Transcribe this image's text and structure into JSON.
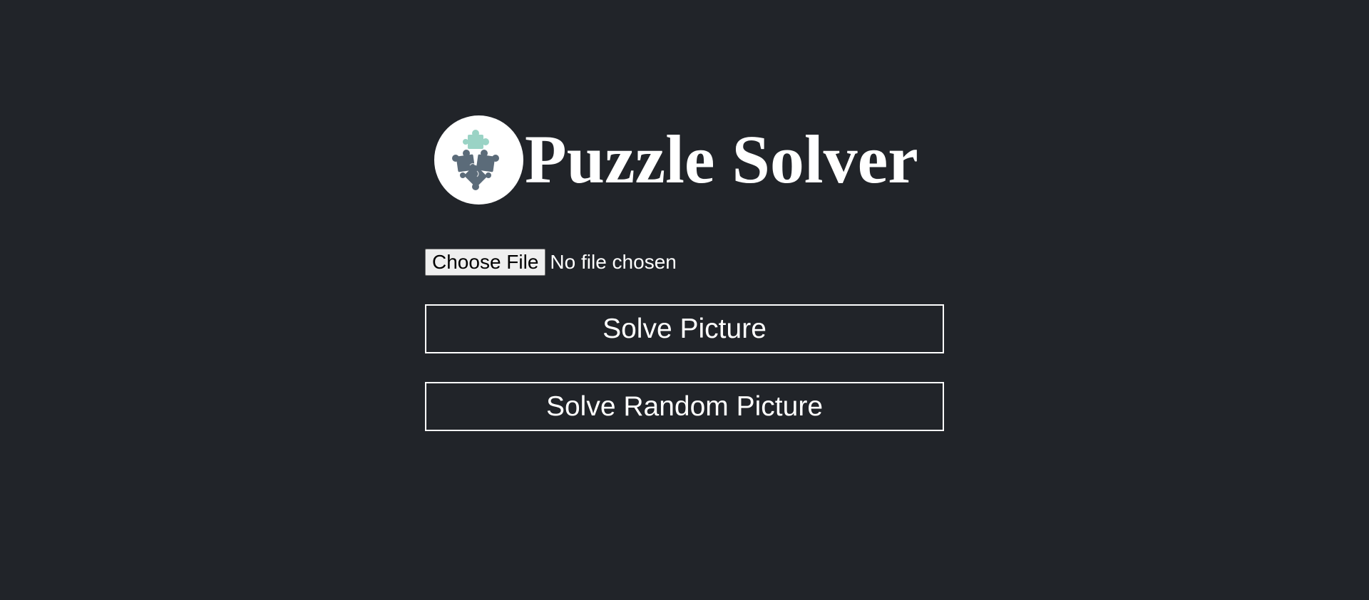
{
  "header": {
    "title": "Puzzle Solver",
    "logo_icon": "puzzle-pieces-icon"
  },
  "file_input": {
    "button_label": "Choose File",
    "status_text": "No file chosen"
  },
  "actions": {
    "solve_label": "Solve Picture",
    "solve_random_label": "Solve Random Picture"
  },
  "colors": {
    "background": "#212429",
    "text": "#ffffff",
    "logo_background": "#ffffff",
    "puzzle_teal": "#9ad3c5",
    "puzzle_slate": "#5b6b79"
  }
}
